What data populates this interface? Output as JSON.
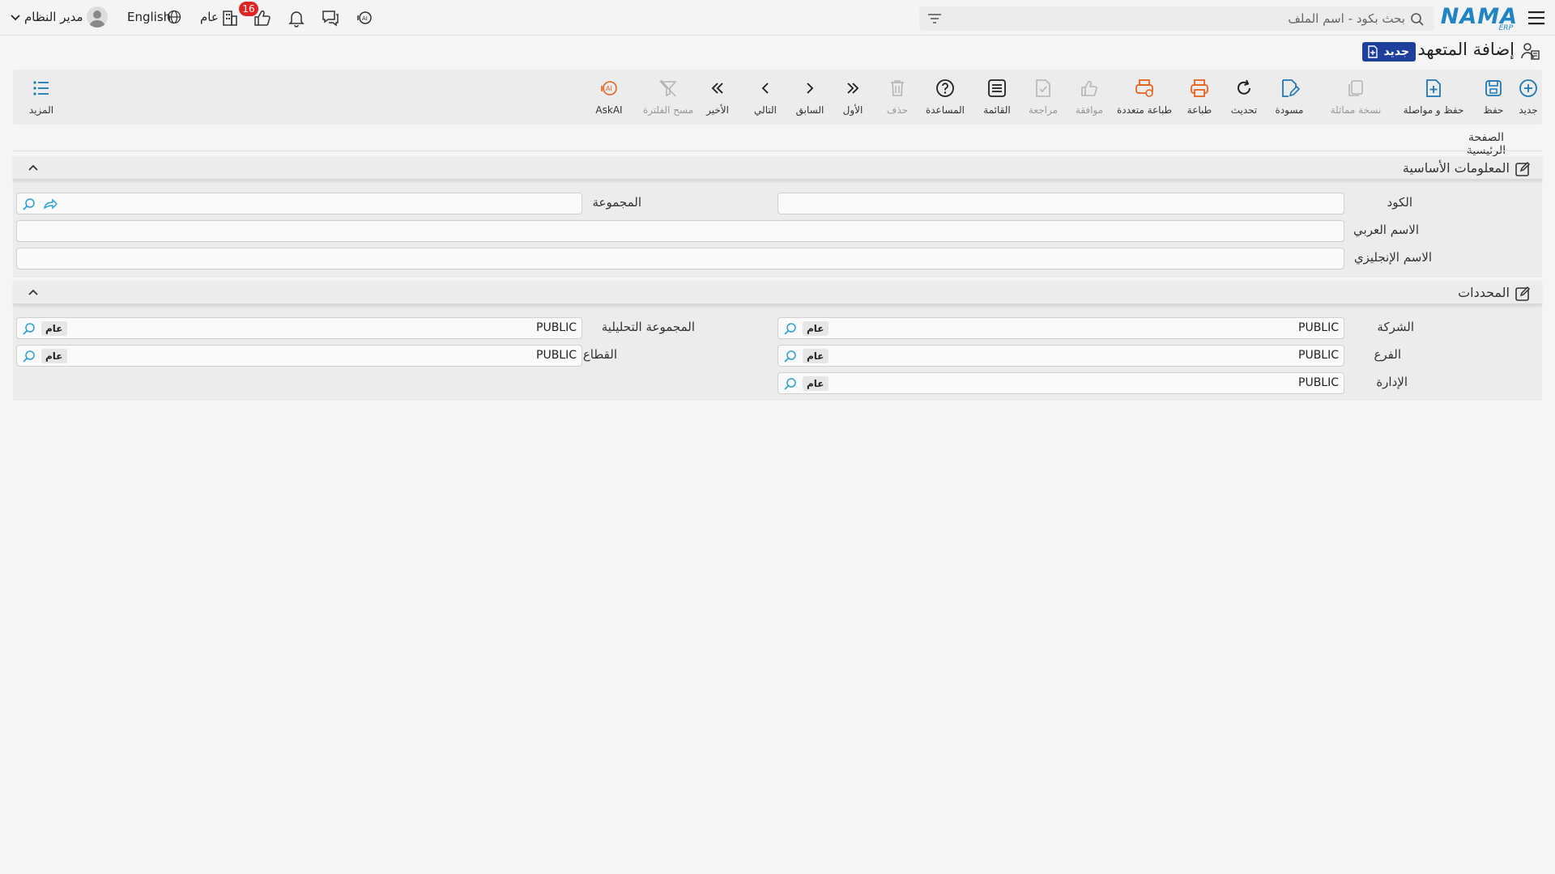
{
  "topbar": {
    "logo_text": "NAMA",
    "logo_sub": "ERP",
    "search_placeholder": "بحث بكود - اسم الملف",
    "notifications_count": "16",
    "scope_label": "عام",
    "language_label": "English",
    "user_label": "مدير النظام"
  },
  "page": {
    "title": "إضافة المتعهد",
    "status_badge": "جديد"
  },
  "toolbar": {
    "new": "جديد",
    "save": "حفظ",
    "save_continue": "حفظ و مواصلة",
    "duplicate": "نسخة مماثلة",
    "draft": "مسودة",
    "refresh": "تحديث",
    "print": "طباعة",
    "multi_print": "طباعة متعددة",
    "approve": "موافقة",
    "review": "مراجعة",
    "list": "القائمة",
    "help": "المساعدة",
    "delete": "حذف",
    "first": "الأول",
    "previous": "السابق",
    "next": "التالي",
    "last": "الأخير",
    "clear_filter": "مسح الفلترة",
    "askai": "AskAI",
    "more": "المزيد"
  },
  "tabs": {
    "main": "الصفحة الرئيسية"
  },
  "basic_info": {
    "title": "المعلومات الأساسية",
    "code_label": "الكود",
    "code_value": "",
    "group_label": "المجموعة",
    "group_value": "",
    "arabic_name_label": "الاسم العربي",
    "arabic_name_value": "",
    "english_name_label": "الاسم الإنجليزي",
    "english_name_value": ""
  },
  "determinants": {
    "title": "المحددات",
    "company_label": "الشركة",
    "company_value": "PUBLIC",
    "company_chip": "عام",
    "analytic_group_label": "المجموعة التحليلية",
    "analytic_group_value": "PUBLIC",
    "analytic_group_chip": "عام",
    "branch_label": "الفرع",
    "branch_value": "PUBLIC",
    "branch_chip": "عام",
    "sector_label": "القطاع",
    "sector_value": "PUBLIC",
    "sector_chip": "عام",
    "department_label": "الإدارة",
    "department_value": "PUBLIC",
    "department_chip": "عام"
  },
  "colors": {
    "brand": "#2185c5",
    "accent_blue": "#1f77b4",
    "accent_orange": "#e8621e",
    "badge_red": "#e02424",
    "status_badge": "#1f3f9c"
  }
}
